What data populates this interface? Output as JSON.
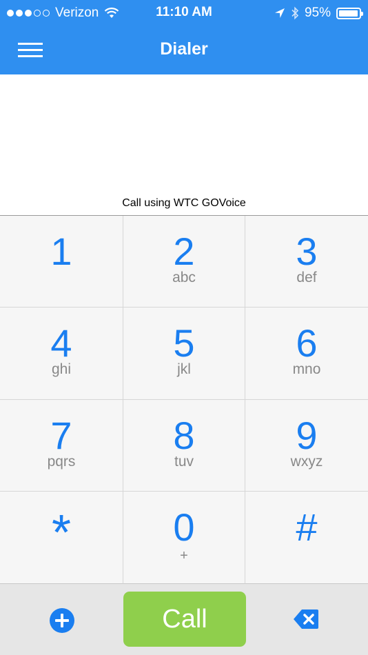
{
  "status_bar": {
    "signal_full": 3,
    "signal_empty": 2,
    "carrier": "Verizon",
    "time": "11:10 AM",
    "battery_percent": "95%",
    "battery_level": 0.95,
    "icons": [
      "wifi-icon",
      "location-arrow-icon",
      "bluetooth-icon",
      "battery-icon"
    ]
  },
  "nav": {
    "title": "Dialer",
    "menu_icon": "hamburger-menu-icon"
  },
  "display": {
    "number": "",
    "call_using": "Call using WTC GOVoice"
  },
  "keypad": {
    "keys": [
      {
        "digit": "1",
        "letters": ""
      },
      {
        "digit": "2",
        "letters": "abc"
      },
      {
        "digit": "3",
        "letters": "def"
      },
      {
        "digit": "4",
        "letters": "ghi"
      },
      {
        "digit": "5",
        "letters": "jkl"
      },
      {
        "digit": "6",
        "letters": "mno"
      },
      {
        "digit": "7",
        "letters": "pqrs"
      },
      {
        "digit": "8",
        "letters": "tuv"
      },
      {
        "digit": "9",
        "letters": "wxyz"
      },
      {
        "digit": "*",
        "letters": ""
      },
      {
        "digit": "0",
        "letters": "+"
      },
      {
        "digit": "#",
        "letters": ""
      }
    ]
  },
  "actions": {
    "add_icon": "plus-circle-icon",
    "call_label": "Call",
    "backspace_icon": "backspace-icon"
  },
  "colors": {
    "header_blue": "#2f8ff0",
    "digit_blue": "#1a7ef0",
    "call_green": "#8fcf4c",
    "keypad_bg": "#f6f6f6",
    "action_bar_bg": "#e6e6e6"
  }
}
